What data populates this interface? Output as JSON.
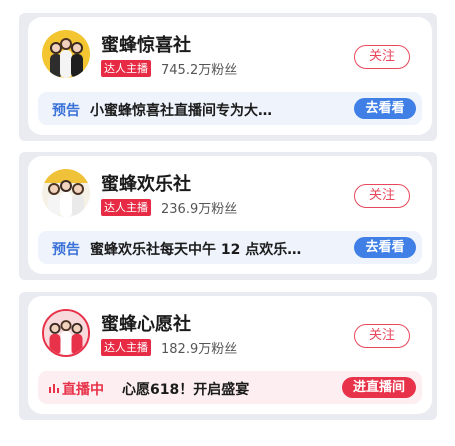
{
  "cards": [
    {
      "name": "蜜蜂惊喜社",
      "badge": "达人主播",
      "fans": "745.2万粉丝",
      "follow": "关注",
      "tag": "预告",
      "text": "小蜜蜂惊喜社直播间专为大…",
      "action": "去看看"
    },
    {
      "name": "蜜蜂欢乐社",
      "badge": "达人主播",
      "fans": "236.9万粉丝",
      "follow": "关注",
      "tag": "预告",
      "text": "蜜蜂欢乐社每天中午 12 点欢乐…",
      "action": "去看看"
    },
    {
      "name": "蜜蜂心愿社",
      "badge": "达人主播",
      "fans": "182.9万粉丝",
      "follow": "关注",
      "tag": "直播中",
      "text": "心愿618！开启盛宴",
      "action": "进直播间"
    }
  ],
  "colors": {
    "accent_red": "#e8324a",
    "accent_blue": "#3f7fe6",
    "card_bg": "#ffffff",
    "page_bg": "#e9ebf1"
  },
  "icons": {
    "live": "live-bars-icon",
    "avatar": "group-photo-avatar"
  }
}
